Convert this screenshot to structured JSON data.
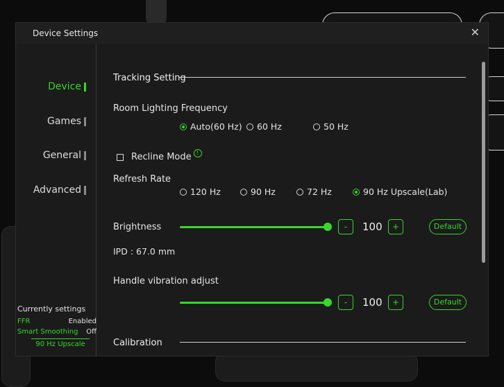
{
  "dialog": {
    "title": "Device Settings",
    "close_glyph": "✕"
  },
  "sidebar": {
    "items": [
      {
        "label": "Device",
        "active": true
      },
      {
        "label": "Games",
        "active": false
      },
      {
        "label": "General",
        "active": false
      },
      {
        "label": "Advanced",
        "active": false
      }
    ]
  },
  "current_settings": {
    "heading": "Currently settings",
    "rows": [
      {
        "key": "FFR",
        "value": "Enabled"
      },
      {
        "key": "Smart Smoothing",
        "value": "Off"
      }
    ],
    "mode": "90 Hz Upscale"
  },
  "tracking": {
    "title": "Tracking Setting",
    "room_lighting_label": "Room Lighting Frequency",
    "room_lighting_options": [
      "Auto(60 Hz)",
      "60 Hz",
      "50 Hz"
    ],
    "room_lighting_selected": "Auto(60 Hz)",
    "recline_label": "Recline Mode",
    "recline_checked": false,
    "info_glyph": "!"
  },
  "refresh": {
    "label": "Refresh Rate",
    "options": [
      "120 Hz",
      "90 Hz",
      "72 Hz",
      "90 Hz Upscale(Lab)"
    ],
    "selected": "90 Hz Upscale(Lab)"
  },
  "brightness": {
    "label": "Brightness",
    "value": "100",
    "level": 1.0,
    "minus": "-",
    "plus": "+",
    "default_label": "Default"
  },
  "ipd": {
    "text": "IPD : 67.0 mm"
  },
  "vibration": {
    "label": "Handle vibration adjust",
    "value": "100",
    "level": 1.0,
    "minus": "-",
    "plus": "+",
    "default_label": "Default"
  },
  "calibration": {
    "title": "Calibration"
  },
  "colors": {
    "accent": "#39d62c",
    "bg": "#1b1b1b"
  }
}
